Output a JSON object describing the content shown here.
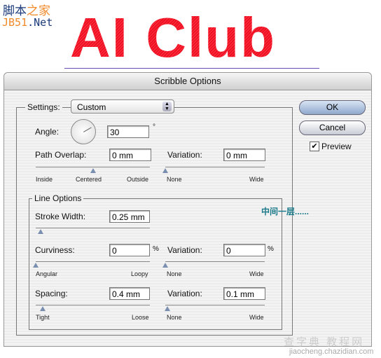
{
  "watermark_top": {
    "line1a": "脚本",
    "line1b": "之家",
    "line2a": "JB51",
    "line2b": ".Net"
  },
  "logo_text": "AI Club",
  "dialog": {
    "title": "Scribble Options",
    "settings_label": "Settings:",
    "settings_value": "Custom",
    "angle_label": "Angle:",
    "angle_value": "30",
    "angle_unit": "°",
    "angle_degrees": 30,
    "path_overlap_label": "Path Overlap:",
    "path_overlap_value": "0 mm",
    "path_overlap_slider": {
      "min_label": "Inside",
      "mid_label": "Centered",
      "max_label": "Outside",
      "position": 0.5
    },
    "overlap_variation_label": "Variation:",
    "overlap_variation_value": "0 mm",
    "overlap_variation_slider": {
      "min_label": "None",
      "max_label": "Wide",
      "position": 0
    },
    "line_options_label": "Line Options",
    "stroke_width_label": "Stroke Width:",
    "stroke_width_value": "0.25 mm",
    "stroke_width_slider": {
      "position": 0.04
    },
    "curviness_label": "Curviness:",
    "curviness_value": "0",
    "curviness_unit": "%",
    "curviness_slider": {
      "min_label": "Angular",
      "max_label": "Loopy",
      "position": 0
    },
    "curv_variation_label": "Variation:",
    "curv_variation_value": "0",
    "curv_variation_unit": "%",
    "curv_variation_slider": {
      "min_label": "None",
      "max_label": "Wide",
      "position": 0
    },
    "spacing_label": "Spacing:",
    "spacing_value": "0.4 mm",
    "spacing_slider": {
      "min_label": "Tight",
      "max_label": "Loose",
      "position": 0.06
    },
    "spacing_variation_label": "Variation:",
    "spacing_variation_value": "0.1 mm",
    "spacing_variation_slider": {
      "min_label": "None",
      "max_label": "Wide",
      "position": 0.02
    },
    "ok_label": "OK",
    "cancel_label": "Cancel",
    "preview_label": "Preview",
    "preview_checked": true
  },
  "annotation": "中间一层......",
  "watermark_bottom": {
    "line1": "查字典 教程网",
    "line2": "jiaocheng.chazidian.com"
  }
}
